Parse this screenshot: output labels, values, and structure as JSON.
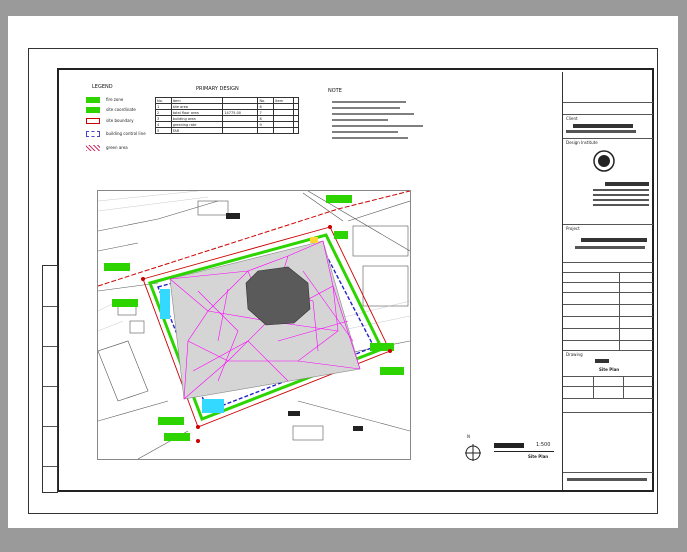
{
  "legend": {
    "title": "LEGEND",
    "items": [
      {
        "color": "#2dd400",
        "label": "fire zone"
      },
      {
        "color": "#2dd400",
        "label": "site coordinate"
      },
      {
        "color": "#cc0000",
        "label": "site boundary"
      },
      {
        "color": "#4444cc",
        "label": "building control line"
      },
      {
        "color": "#cc3366",
        "label": "green area"
      }
    ]
  },
  "area_table": {
    "title": "PRIMARY DESIGN",
    "rows": [
      [
        "No.",
        "item",
        "",
        "No.",
        "item",
        ""
      ],
      [
        "1",
        "site area",
        "",
        "6",
        "",
        ""
      ],
      [
        "2",
        "total floor area",
        "14775.00",
        "7",
        "",
        ""
      ],
      [
        "3",
        "building area",
        "",
        "8",
        "",
        ""
      ],
      [
        "4",
        "greening rate",
        "",
        "9",
        "",
        ""
      ],
      [
        "5",
        "FAR",
        "",
        "",
        "",
        ""
      ]
    ]
  },
  "notes": {
    "title": "NOTE"
  },
  "title_block": {
    "client_label": "Client",
    "design_institute_label": "Design Institute",
    "project_label": "Project",
    "drawing_label": "Drawing",
    "drawing_title_en": "Site Plan"
  },
  "plan": {
    "scale": "1:500",
    "label_en": "Site Plan",
    "north_label": "N"
  },
  "colors": {
    "frame": "#222222",
    "background": "#9a9a9a",
    "site_line": "#cc0000",
    "fire_zone": "#2dd400",
    "mesh": "#ff00ff",
    "building_line": "#2222cc",
    "cyan": "#33d9ff"
  }
}
